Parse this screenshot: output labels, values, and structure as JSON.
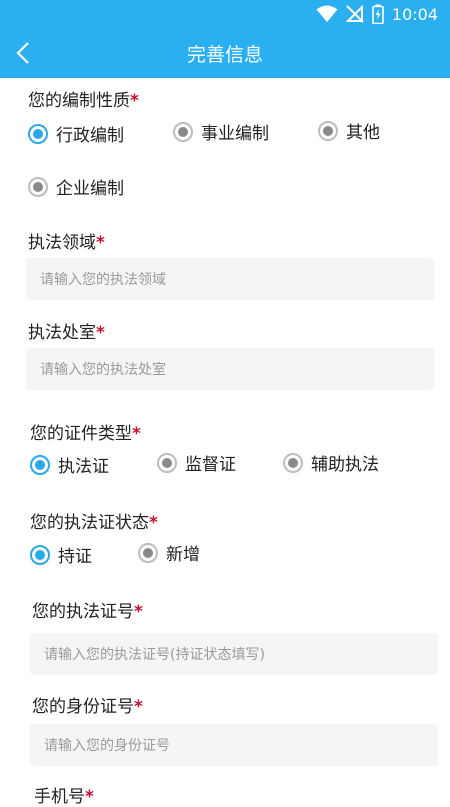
{
  "status": {
    "time": "10:04",
    "icons": [
      "wifi-icon",
      "no-signal-icon",
      "battery-charging-icon"
    ]
  },
  "header": {
    "title": "完善信息",
    "back_icon": "chevron-left-icon"
  },
  "colors": {
    "primary": "#2ab0f0",
    "radio_checked": "#29a9ea",
    "required": "#c8102e",
    "field_bg": "#f5f5f5"
  },
  "form": {
    "required_mark": "*",
    "staffing": {
      "label": "您的编制性质",
      "options": [
        "行政编制",
        "事业编制",
        "其他",
        "企业编制"
      ],
      "selected": "行政编制"
    },
    "field_area": {
      "label": "执法领域",
      "placeholder": "请输入您的执法领域"
    },
    "office": {
      "label": "执法处室",
      "placeholder": "请输入您的执法处室"
    },
    "cert_type": {
      "label": "您的证件类型",
      "options": [
        "执法证",
        "监督证",
        "辅助执法"
      ],
      "selected": "执法证"
    },
    "cert_status": {
      "label": "您的执法证状态",
      "options": [
        "持证",
        "新增"
      ],
      "selected": "持证"
    },
    "cert_number": {
      "label": "您的执法证号",
      "placeholder": "请输入您的执法证号(持证状态填写)"
    },
    "id_number": {
      "label": "您的身份证号",
      "placeholder": "请输入您的身份证号"
    },
    "phone": {
      "label": "手机号"
    }
  }
}
